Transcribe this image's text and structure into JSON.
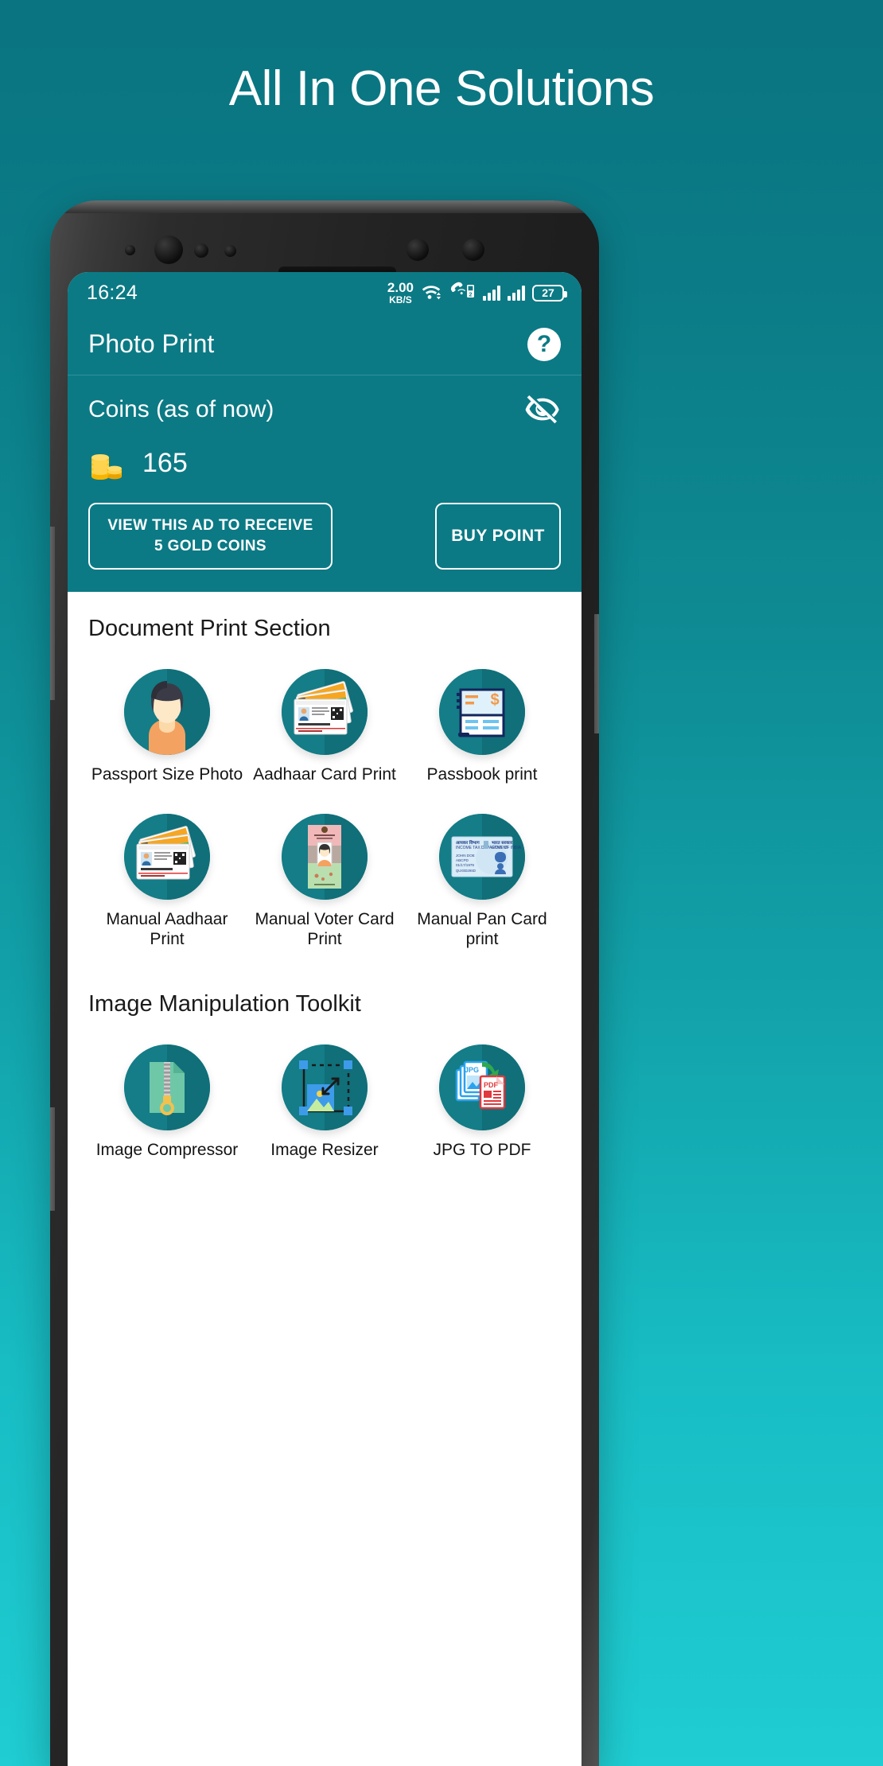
{
  "promo": {
    "headline": "All In One Solutions"
  },
  "status_bar": {
    "time": "16:24",
    "net_speed_value": "2.00",
    "net_speed_unit": "KB/S",
    "wifi_icon": "wifi-icon",
    "call_icon": "vowifi-call-icon",
    "sim1_icon": "signal-bars-icon",
    "sim2_icon": "signal-bars-icon",
    "battery_percent": "27"
  },
  "app_bar": {
    "title": "Photo Print",
    "help_label": "?"
  },
  "coins": {
    "label": "Coins (as of now)",
    "value": "165",
    "hide_icon": "eye-off-icon",
    "coin_icon": "coin-stack-icon",
    "ad_button": "VIEW THIS AD TO RECEIVE 5 GOLD COINS",
    "ad_button_line1": "VIEW THIS AD TO RECEIVE",
    "ad_button_line2": "5 GOLD COINS",
    "buy_button": "BUY POINT"
  },
  "sections": [
    {
      "title": "Document Print Section",
      "tiles": [
        {
          "label": "Passport Size Photo",
          "icon": "passport-photo-icon"
        },
        {
          "label": "Aadhaar Card Print",
          "icon": "aadhaar-cards-icon"
        },
        {
          "label": "Passbook print",
          "icon": "passbook-icon"
        },
        {
          "label": "Manual Aadhaar Print",
          "icon": "aadhaar-cards-icon"
        },
        {
          "label": "Manual Voter Card Print",
          "icon": "voter-card-icon"
        },
        {
          "label": "Manual Pan Card print",
          "icon": "pan-card-icon"
        }
      ]
    },
    {
      "title": "Image Manipulation Toolkit",
      "tiles": [
        {
          "label": "Image Compressor",
          "icon": "zip-file-icon"
        },
        {
          "label": "Image Resizer",
          "icon": "resize-image-icon"
        },
        {
          "label": "JPG TO PDF",
          "icon": "jpg-to-pdf-icon"
        }
      ]
    }
  ],
  "colors": {
    "brand_teal": "#0b7a85",
    "tile_circle": "#147d87",
    "bg_top": "#0a7480",
    "bg_bottom": "#1fcdd2",
    "coin_gold": "#f5b922"
  }
}
